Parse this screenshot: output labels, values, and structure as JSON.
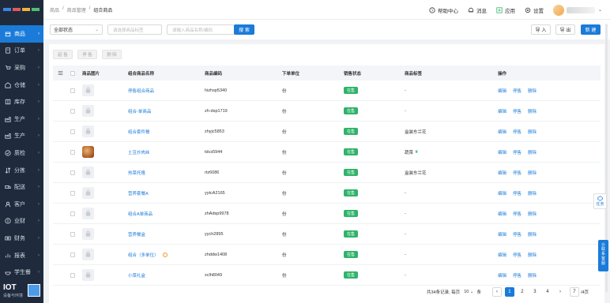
{
  "sidebar": {
    "items": [
      {
        "label": "商品",
        "icon": "box-icon"
      },
      {
        "label": "订单",
        "icon": "order-icon"
      },
      {
        "label": "采购",
        "icon": "cart-icon"
      },
      {
        "label": "仓储",
        "icon": "warehouse-icon"
      },
      {
        "label": "库存",
        "icon": "stock-icon"
      },
      {
        "label": "生产",
        "icon": "factory-icon"
      },
      {
        "label": "生产",
        "icon": "factory-icon"
      },
      {
        "label": "质检",
        "icon": "check-icon"
      },
      {
        "label": "分拣",
        "icon": "sort-icon"
      },
      {
        "label": "配送",
        "icon": "truck-icon"
      },
      {
        "label": "客户",
        "icon": "user-icon"
      },
      {
        "label": "业财",
        "icon": "finance-icon"
      },
      {
        "label": "财务",
        "icon": "money-icon"
      },
      {
        "label": "报表",
        "icon": "chart-icon"
      },
      {
        "label": "学生餐",
        "icon": "meal-icon"
      }
    ],
    "active_index": 0,
    "iot_title": "IOT",
    "iot_sub": "设备与环境"
  },
  "breadcrumb": [
    "商品",
    "商品管理",
    "组合商品"
  ],
  "topbar": {
    "help": "帮助中心",
    "messages": "消息",
    "apps": "应用",
    "settings": "设置"
  },
  "filter": {
    "status_value": "全部状态",
    "tag_placeholder": "请选择商品标签",
    "keyword_placeholder": "请输入商品名称/编码",
    "search_label": "搜 索",
    "import_label": "导 入",
    "export_label": "导 出",
    "new_label": "新 建"
  },
  "bulk_actions": [
    "起 售",
    "停 售",
    "删 除"
  ],
  "table": {
    "headers": [
      "商品图片",
      "组合商品名称",
      "商品编码",
      "下单单位",
      "销售状态",
      "商品标签",
      "操作"
    ],
    "rows": [
      {
        "name": "停售组合商品",
        "code": "hizhsp5340",
        "unit": "份",
        "status": "在售",
        "tag": "-",
        "img": "placeholder"
      },
      {
        "name": "组合-单商品",
        "code": "zh-dsp1719",
        "unit": "份",
        "status": "在售",
        "tag": "-",
        "img": "placeholder"
      },
      {
        "name": "组合套件餐",
        "code": "zhyjc5853",
        "unit": "份",
        "status": "在售",
        "tag": "盒装东兰花",
        "img": "placeholder"
      },
      {
        "name": "土豆炒肉丝",
        "code": "tdcs5944",
        "unit": "份",
        "status": "在售",
        "tag": "蔬菜",
        "img": "food"
      },
      {
        "name": "热菜托隆",
        "code": "rtz6086",
        "unit": "份",
        "status": "在售",
        "tag": "盒装东兰花",
        "img": "placeholder"
      },
      {
        "name": "营养套餐A",
        "code": "yytcA2165",
        "unit": "份",
        "status": "在售",
        "tag": "-",
        "img": "placeholder"
      },
      {
        "name": "组合A单商品",
        "code": "zhAdsp9978",
        "unit": "份",
        "status": "在售",
        "tag": "-",
        "img": "placeholder"
      },
      {
        "name": "营养餐盒",
        "code": "yych2895",
        "unit": "份",
        "status": "在售",
        "tag": "-",
        "img": "placeholder"
      },
      {
        "name": "组合（多单位）",
        "code": "zhddw1408",
        "unit": "份",
        "status": "在售",
        "tag": "-",
        "img": "placeholder",
        "info": true
      },
      {
        "name": "小菜礼盒",
        "code": "xclh8049",
        "unit": "份",
        "status": "在售",
        "tag": "-",
        "img": "placeholder"
      }
    ],
    "ops": [
      "编辑",
      "停售",
      "删除"
    ]
  },
  "pagination": {
    "total": "共34条记录, 每页",
    "per_page": "10",
    "unit": "条",
    "pages": [
      "1",
      "2",
      "3",
      "4"
    ],
    "current": "1",
    "goto": "7",
    "total_pages": "/4页"
  },
  "widgets": {
    "task": "任务",
    "cs": "联系客服"
  },
  "colors": {
    "accent": "#1a7bd9",
    "sidebar": "#1f2b3d",
    "status": "#2fb36a"
  }
}
